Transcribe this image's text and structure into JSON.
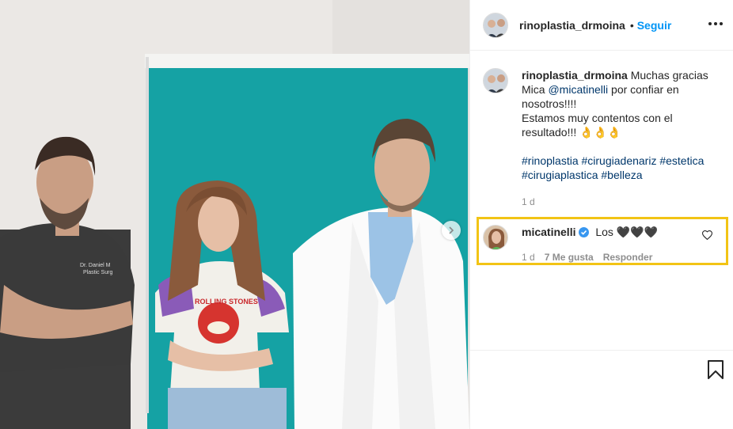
{
  "post": {
    "author": "rinoplastia_drmoina",
    "follow_label": "Seguir",
    "dot": "•",
    "caption": {
      "author": "rinoplastia_drmoina",
      "line1_pre": "Muchas gracias Mica",
      "mention": "@micatinelli",
      "line1_post": "por confiar en nosotros!!!!",
      "line2": "Estamos muy contentos con el resultado!!! 👌👌👌",
      "hashtags": [
        "#rinoplastia",
        "#cirugiadenariz",
        "#estetica",
        "#cirugiaplastica",
        "#belleza"
      ],
      "time": "1 d"
    },
    "comment": {
      "username": "micatinelli",
      "text": "Los 🖤🖤🖤",
      "time": "1 d",
      "likes": "7 Me gusta",
      "reply": "Responder"
    }
  },
  "photo": {
    "coat_badge": "Dr. Daniel M\nPlastic Surg",
    "shirt_text": "ROLLING STONES"
  },
  "colors": {
    "link": "#0095f6",
    "highlight": "#f2c415",
    "teal": "#15a2a4"
  },
  "icons": [
    "more-options-icon",
    "verified-icon",
    "heart-icon",
    "bookmark-icon",
    "next-arrow-icon"
  ]
}
